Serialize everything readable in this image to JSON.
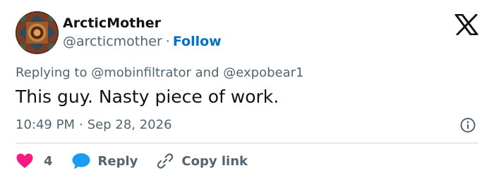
{
  "user": {
    "display_name": "ArcticMother",
    "handle": "@arcticmother",
    "separator": "·",
    "follow_label": "Follow"
  },
  "reply": {
    "prefix": "Replying to",
    "mention_1": "@mobinfiltrator",
    "conjunction": "and",
    "mention_2": "@expobear1"
  },
  "tweet": {
    "text": "This guy. Nasty piece of work."
  },
  "meta": {
    "time": "10:49 PM",
    "separator": "·",
    "date": "Sep 28, 2026"
  },
  "actions": {
    "like_count": "4",
    "reply_label": "Reply",
    "copy_link_label": "Copy link"
  },
  "colors": {
    "text": "#0f1419",
    "secondary": "#536471",
    "follow": "#0071c3",
    "heart": "#f91880",
    "reply_bubble": "#1d9bf0",
    "divider": "#cfd9de"
  },
  "icons": {
    "logo": "x-logo-icon",
    "info": "info-icon",
    "like": "heart-icon",
    "reply": "reply-bubble-icon",
    "copy": "link-icon"
  }
}
